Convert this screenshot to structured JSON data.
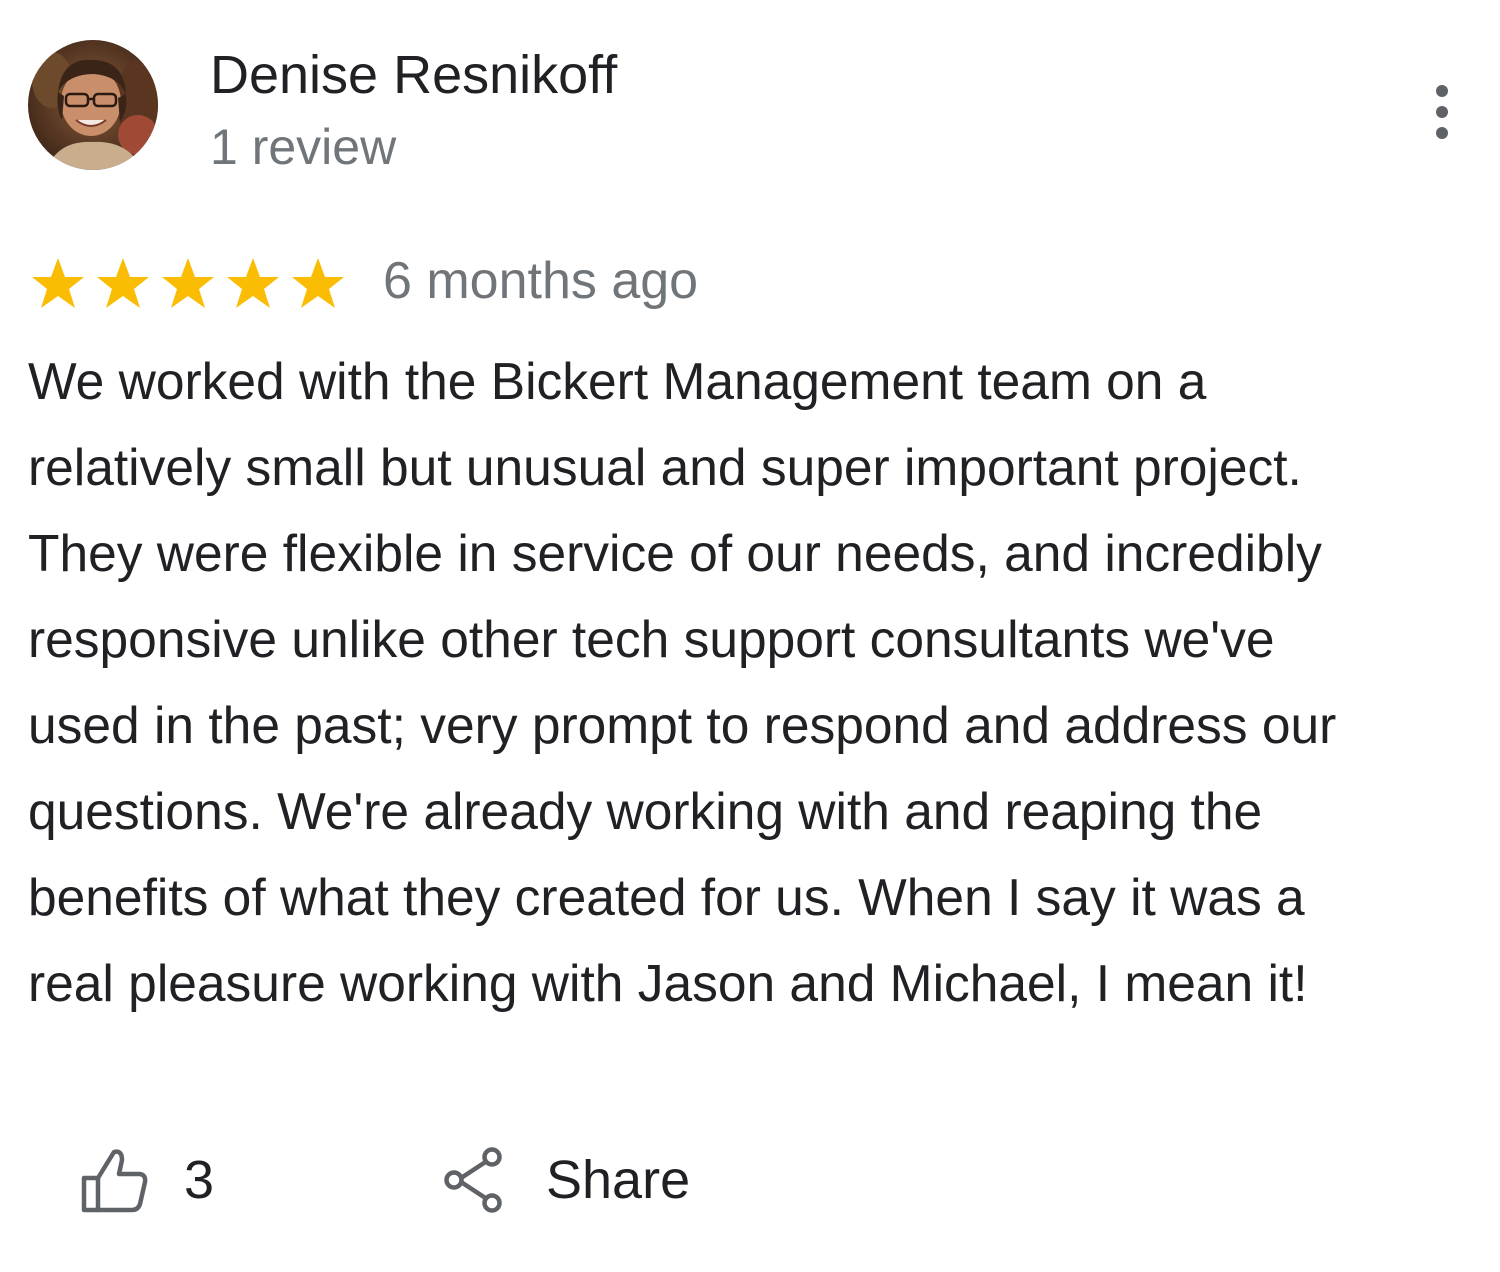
{
  "reviewer": {
    "name": "Denise Resnikoff",
    "review_count": "1 review"
  },
  "review": {
    "rating": 5,
    "max_rating": 5,
    "date": "6 months ago",
    "lines": [
      "We worked with the Bickert Management team on a",
      "relatively small but unusual and super important project.",
      "They were flexible in service of our needs, and incredibly",
      "responsive unlike other tech support consultants we've",
      "used in the past; very prompt to respond and address our",
      "questions. We're already working with and reaping the",
      "benefits of what they created for us. When I say it was a",
      "real pleasure working with Jason and Michael, I mean it!"
    ]
  },
  "actions": {
    "like_count": "3",
    "share_label": "Share"
  },
  "icons": {
    "more": "more-vert-icon",
    "star": "star-icon",
    "like": "thumb-up-icon",
    "share": "share-icon"
  },
  "colors": {
    "star": "#fbbc04",
    "text": "#202124",
    "secondary_text": "#70757a",
    "icon": "#5f6368"
  }
}
